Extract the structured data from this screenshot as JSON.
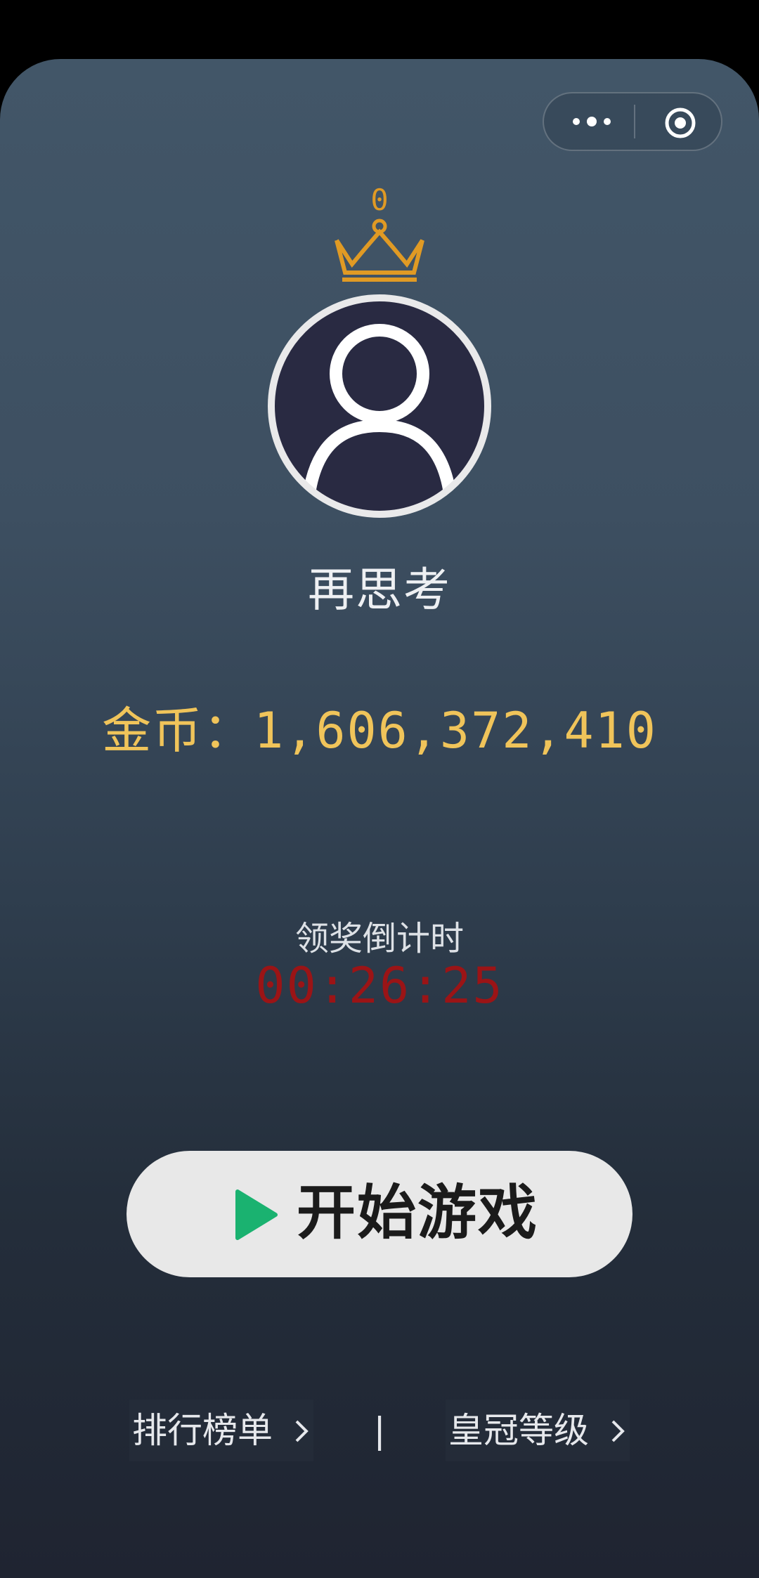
{
  "capsule": {
    "more_icon": "more-dots-icon",
    "close_icon": "circle-target-icon"
  },
  "profile": {
    "crown_level": "0",
    "crown_icon": "crown-icon",
    "avatar_icon": "default-user-avatar",
    "username": "再思考"
  },
  "coins": {
    "label": "金币：",
    "value": "1,606,372,410"
  },
  "countdown": {
    "label": "领奖倒计时",
    "time": "00:26:25"
  },
  "start_button": {
    "label": "开始游戏",
    "icon": "play-icon"
  },
  "links": {
    "rank": "排行榜单",
    "separator": "|",
    "crown_level": "皇冠等级"
  },
  "colors": {
    "gold": "#f0c45a",
    "crown": "#e09a24",
    "countdown": "#9b1416",
    "play": "#1ab270"
  }
}
